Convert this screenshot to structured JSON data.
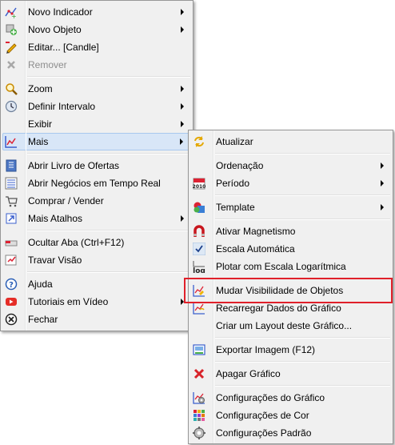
{
  "main_menu": {
    "items": [
      {
        "label": "Novo Indicador",
        "icon": "indicator-add-icon"
      },
      {
        "label": "Novo Objeto",
        "icon": "object-add-icon"
      },
      {
        "label": "Editar... [Candle]",
        "icon": "pencil-icon"
      },
      {
        "label": "Remover",
        "icon": "remove-icon"
      },
      {
        "label": "Zoom",
        "icon": "magnifier-icon"
      },
      {
        "label": "Definir Intervalo",
        "icon": "clock-icon"
      },
      {
        "label": "Exibir",
        "icon": ""
      },
      {
        "label": "Mais",
        "icon": "chart-icon"
      },
      {
        "label": "Abrir Livro de Ofertas",
        "icon": "book-icon"
      },
      {
        "label": "Abrir Negócios em Tempo Real",
        "icon": "list-icon"
      },
      {
        "label": "Comprar / Vender",
        "icon": "cart-icon"
      },
      {
        "label": "Mais Atalhos",
        "icon": "shortcut-icon"
      },
      {
        "label": "Ocultar Aba (Ctrl+F12)",
        "icon": "tab-hide-icon"
      },
      {
        "label": "Travar Visão",
        "icon": "lock-view-icon"
      },
      {
        "label": "Ajuda",
        "icon": "help-icon"
      },
      {
        "label": "Tutoriais em Vídeo",
        "icon": "youtube-icon"
      },
      {
        "label": "Fechar",
        "icon": "close-icon"
      }
    ]
  },
  "sub_menu": {
    "items": [
      {
        "label": "Atualizar",
        "icon": "refresh-icon"
      },
      {
        "label": "Ordenação",
        "icon": ""
      },
      {
        "label": "Período",
        "icon": "calendar-icon"
      },
      {
        "label": "Template",
        "icon": "template-icon"
      },
      {
        "label": "Ativar Magnetismo",
        "icon": "magnet-icon"
      },
      {
        "label": "Escala Automática",
        "icon": "check-icon"
      },
      {
        "label": "Plotar com Escala Logarítmica",
        "icon": "log-icon"
      },
      {
        "label": "Mudar Visibilidade de Objetos",
        "icon": "visibility-icon"
      },
      {
        "label": "Recarregar Dados do Gráfico",
        "icon": "reload-chart-icon"
      },
      {
        "label": "Criar um Layout deste Gráfico...",
        "icon": ""
      },
      {
        "label": "Exportar Imagem (F12)",
        "icon": "export-image-icon"
      },
      {
        "label": "Apagar Gráfico",
        "icon": "delete-icon"
      },
      {
        "label": "Configurações do Gráfico",
        "icon": "chart-settings-icon"
      },
      {
        "label": "Configurações de Cor",
        "icon": "color-settings-icon"
      },
      {
        "label": "Configurações Padrão",
        "icon": "default-settings-icon"
      }
    ]
  },
  "calendar_icon_text": "2010",
  "log_icon_text": "log",
  "colors": {
    "highlight": "#e0202a",
    "hover_bg": "#d8e6f7"
  }
}
